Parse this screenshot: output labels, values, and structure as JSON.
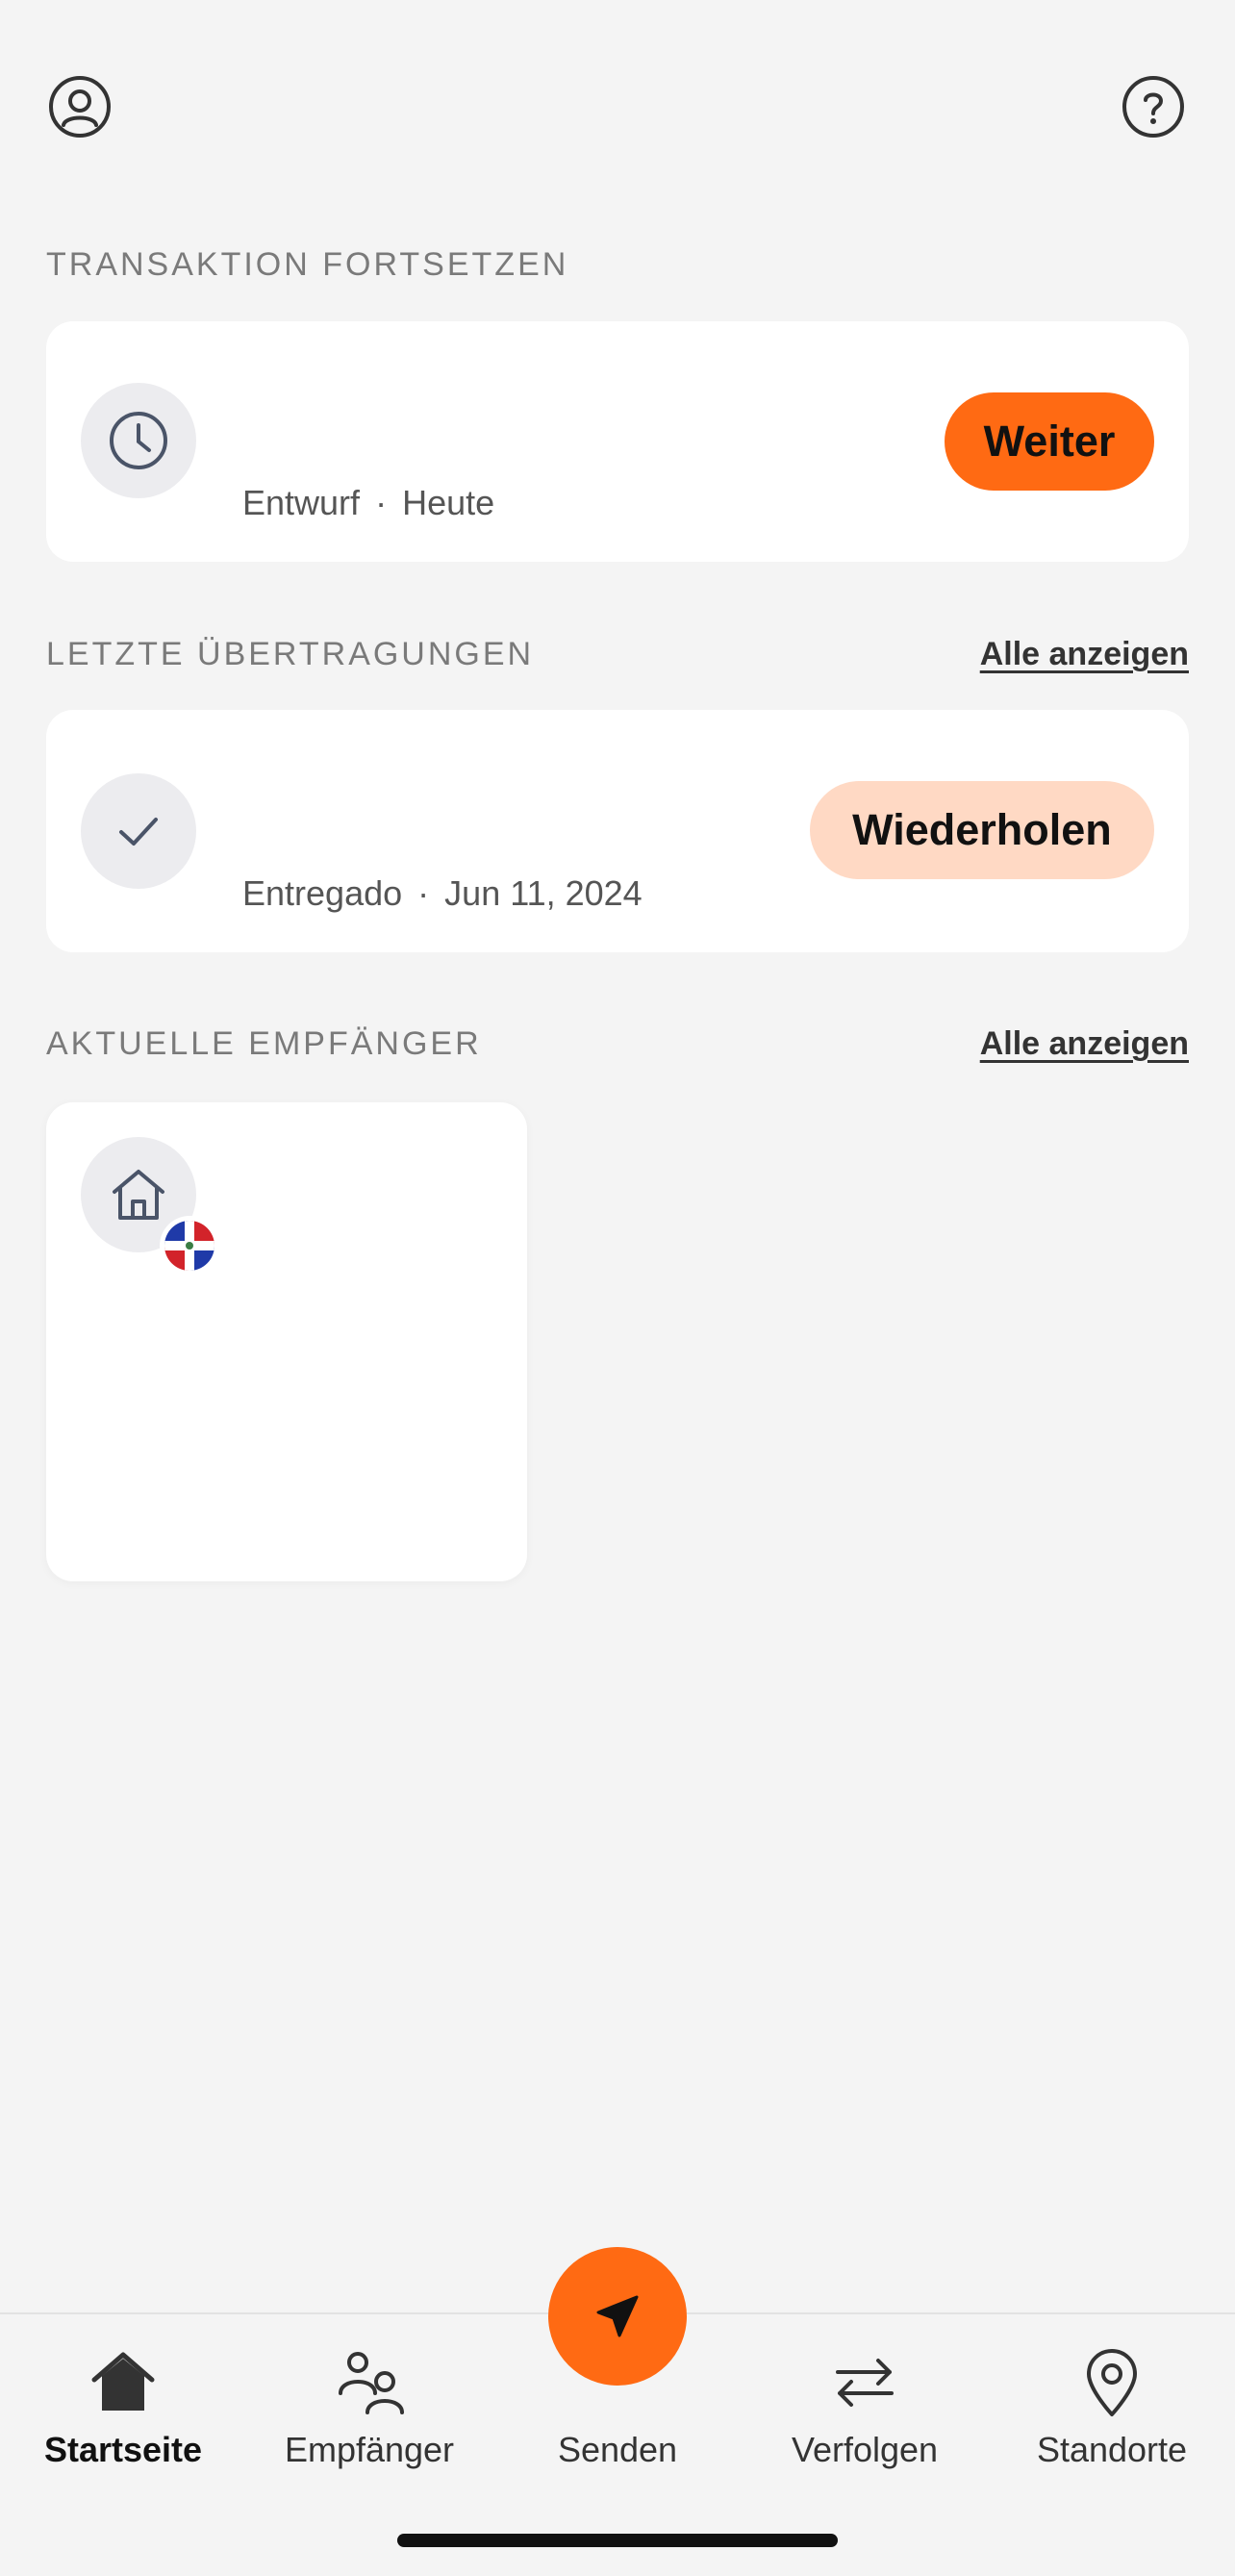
{
  "header": {
    "profile_icon": "user-circle-icon",
    "help_icon": "question-circle-icon"
  },
  "continue_section": {
    "title": "TRANSAKTION FORTSETZEN",
    "card": {
      "icon": "clock-icon",
      "status": "Entwurf",
      "separator": "·",
      "date": "Heute",
      "button_label": "Weiter"
    }
  },
  "transfers_section": {
    "title": "LETZTE ÜBERTRAGUNGEN",
    "see_all": "Alle anzeigen",
    "card": {
      "icon": "check-icon",
      "status": "Entregado",
      "separator": "·",
      "date": "Jun 11, 2024",
      "button_label": "Wiederholen"
    }
  },
  "recipients_section": {
    "title": "AKTUELLE EMPFÄNGER",
    "see_all": "Alle anzeigen",
    "recipient": {
      "icon": "home-icon",
      "flag": "dominican-republic-flag-icon"
    }
  },
  "bottom_nav": {
    "items": [
      {
        "label": "Startseite",
        "icon": "home-icon",
        "active": true
      },
      {
        "label": "Empfänger",
        "icon": "people-icon",
        "active": false
      },
      {
        "label": "Senden",
        "icon": "send-icon",
        "active": false
      },
      {
        "label": "Verfolgen",
        "icon": "arrows-swap-icon",
        "active": false
      },
      {
        "label": "Standorte",
        "icon": "location-pin-icon",
        "active": false
      }
    ]
  },
  "colors": {
    "accent": "#ff6a13",
    "accent_soft": "#ffd9c4",
    "background": "#f4f4f4"
  }
}
